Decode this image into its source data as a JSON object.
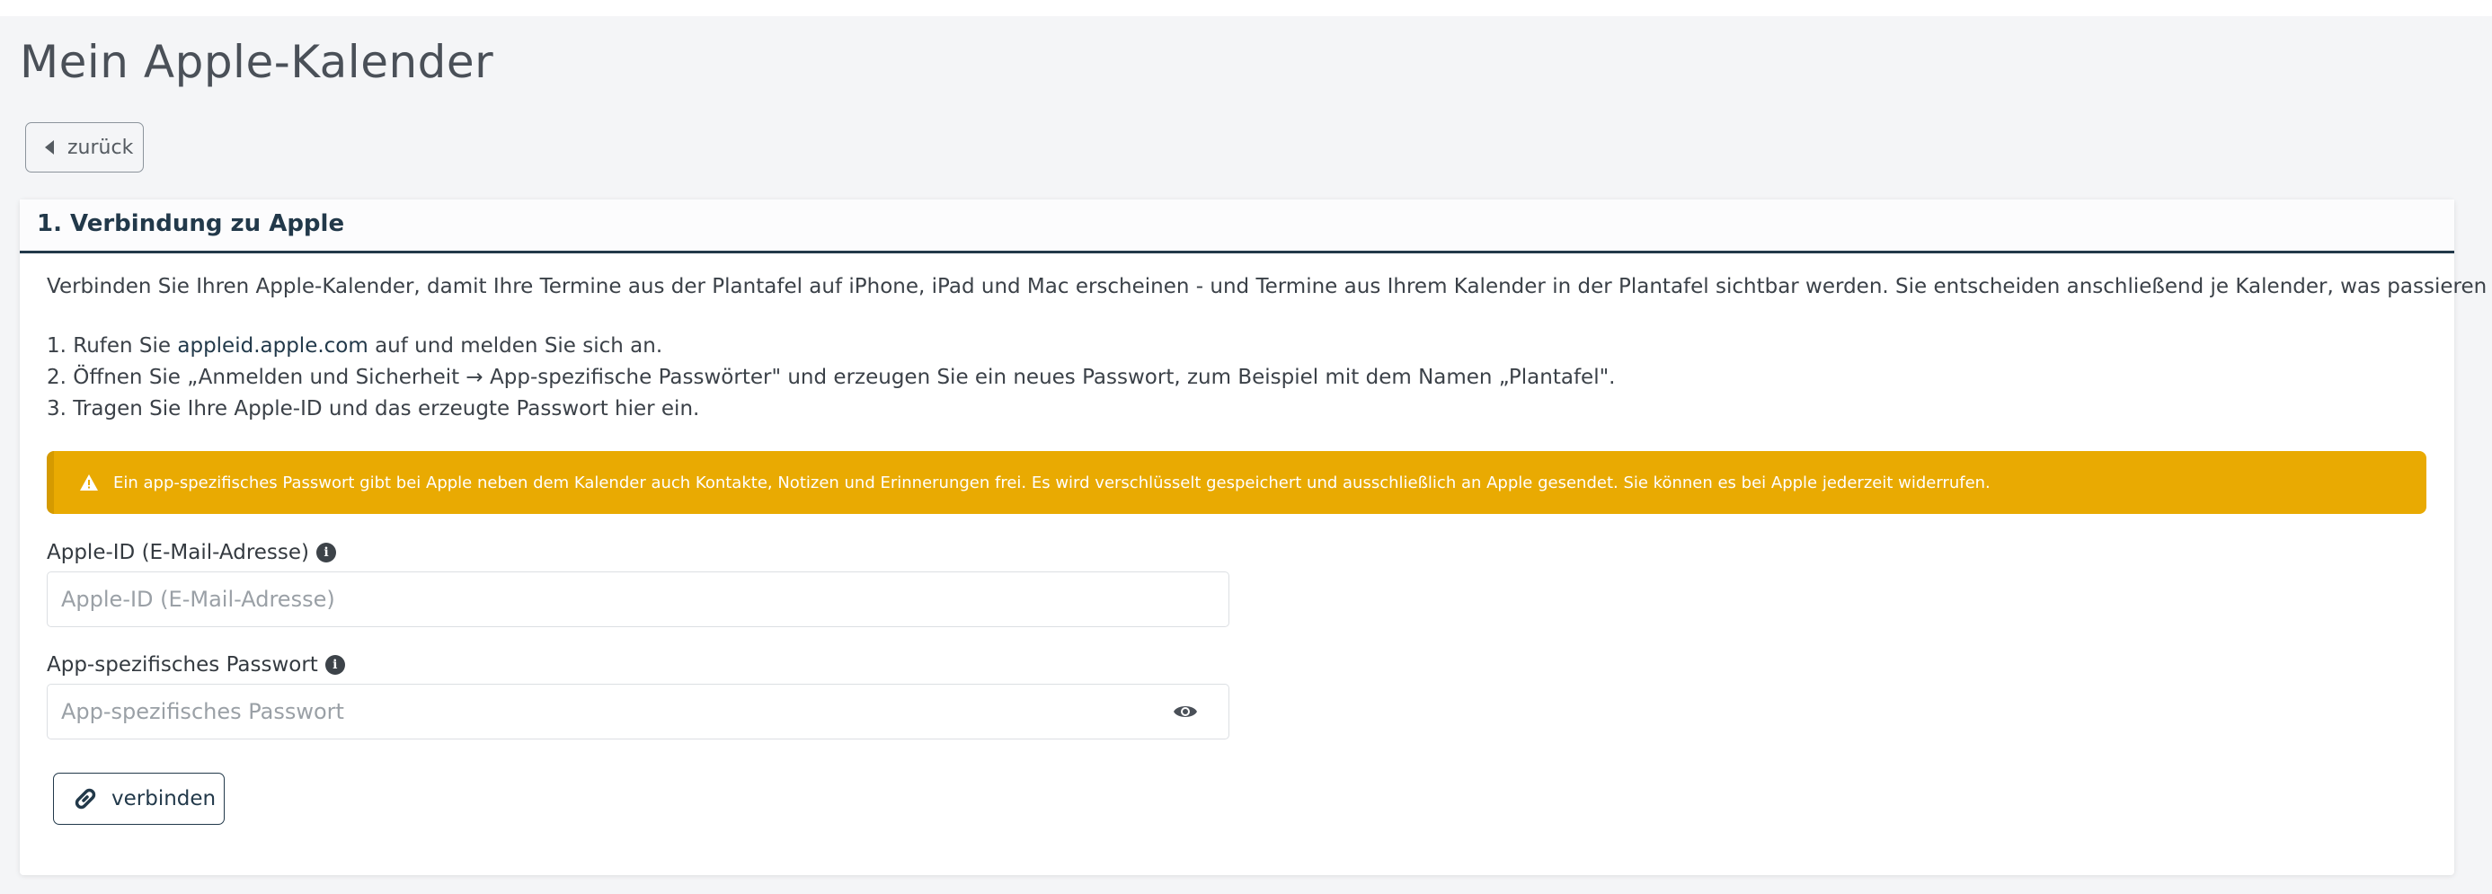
{
  "page": {
    "title": "Mein Apple-Kalender",
    "back_label": "zurück"
  },
  "section": {
    "title": "1. Verbindung zu Apple",
    "intro": "Verbinden Sie Ihren Apple-Kalender, damit Ihre Termine aus der Plantafel auf iPhone, iPad und Mac erscheinen - und Termine aus Ihrem Kalender in der Plantafel sichtbar werden. Sie entscheiden anschließend je Kalender, was passieren soll.",
    "steps": {
      "step1_prefix": "1. Rufen Sie ",
      "step1_link": "appleid.apple.com",
      "step1_suffix": " auf und melden Sie sich an.",
      "step2": "2. Öffnen Sie „Anmelden und Sicherheit → App-spezifische Passwörter\" und erzeugen Sie ein neues Passwort, zum Beispiel mit dem Namen „Plantafel\".",
      "step3": "3. Tragen Sie Ihre Apple-ID und das erzeugte Passwort hier ein."
    },
    "alert": {
      "icon": "warning-icon",
      "color": "#e9aa02",
      "text": "Ein app-spezifisches Passwort gibt bei Apple neben dem Kalender auch Kontakte, Notizen und Erinnerungen frei. Es wird verschlüsselt gespeichert und ausschließlich an Apple gesendet. Sie können es bei Apple jederzeit widerrufen."
    },
    "apple_id": {
      "label": "Apple-ID (E-Mail-Adresse)",
      "placeholder": "Apple-ID (E-Mail-Adresse)",
      "value": ""
    },
    "password": {
      "label": "App-spezifisches Passwort",
      "placeholder": "App-spezifisches Passwort",
      "value": ""
    },
    "connect_label": "verbinden"
  },
  "colors": {
    "primary": "#22394a",
    "warning": "#e9aa02",
    "background": "#f4f5f7"
  }
}
